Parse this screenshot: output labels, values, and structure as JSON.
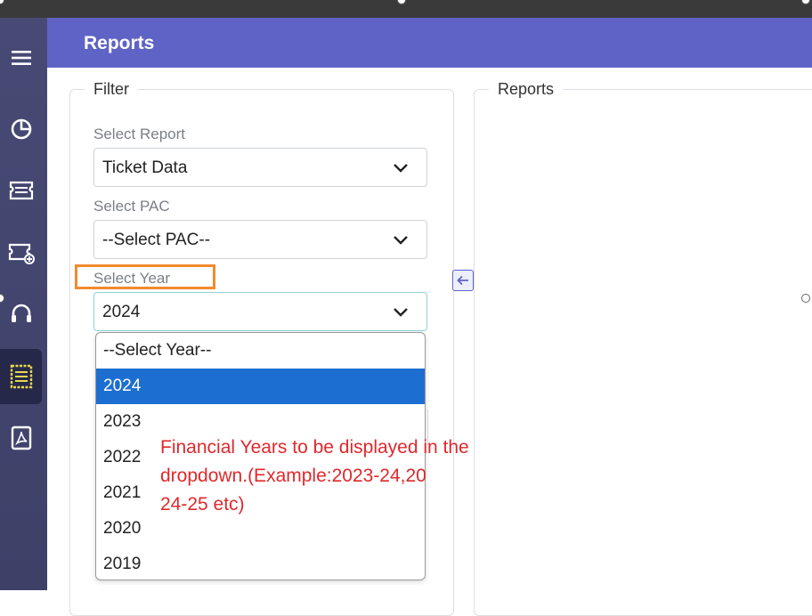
{
  "header": {
    "title": "Reports"
  },
  "sidebar": {
    "items": [
      {
        "name": "menu",
        "icon": "hamburger-menu-icon"
      },
      {
        "name": "dashboard",
        "icon": "pie-chart-icon"
      },
      {
        "name": "tickets",
        "icon": "ticket-stack-icon"
      },
      {
        "name": "add-ticket",
        "icon": "ticket-add-icon"
      },
      {
        "name": "support",
        "icon": "headset-icon"
      },
      {
        "name": "reports",
        "icon": "report-document-icon",
        "active": true
      },
      {
        "name": "pdf",
        "icon": "pdf-file-icon"
      }
    ]
  },
  "filter": {
    "legend": "Filter",
    "select_report": {
      "label": "Select Report",
      "value": "Ticket Data"
    },
    "select_pac": {
      "label": "Select PAC",
      "value": "--Select PAC--"
    },
    "select_year": {
      "label": "Select Year",
      "value": "2024",
      "options": [
        "--Select Year--",
        "2024",
        "2023",
        "2022",
        "2021",
        "2020",
        "2019"
      ],
      "selected_index": 1
    }
  },
  "reports_panel": {
    "legend": "Reports"
  },
  "annotation": {
    "text": "Financial Years to be displayed in the\ndropdown.(Example:2023-24,20\n24-25 etc)",
    "color": "#e0282c"
  },
  "colors": {
    "header": "#5f63c6",
    "sidebar": "#434670",
    "highlight_outline": "#f28a2e",
    "selected_option": "#1d6ed1"
  }
}
